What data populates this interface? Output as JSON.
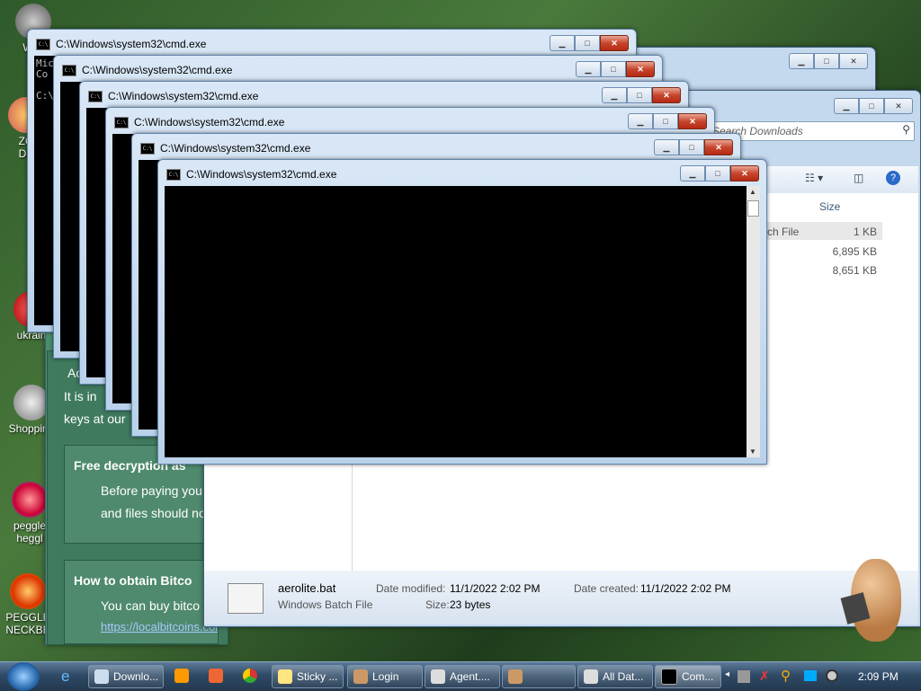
{
  "desktop_icons": [
    {
      "label": "WIN",
      "sub": "W"
    },
    {
      "label": "ZO",
      "sub": "DE"
    },
    {
      "label": "ukrain"
    },
    {
      "label": "Shopping"
    },
    {
      "label": "peggle",
      "sub": "heggl"
    },
    {
      "label": "PEGGLE",
      "sub": "NECKBE"
    }
  ],
  "cmd_windows": [
    {
      "title": "C:\\Windows\\system32\\cmd.exe"
    },
    {
      "title": "C:\\Windows\\system32\\cmd.exe"
    },
    {
      "title": "C:\\Windows\\system32\\cmd.exe"
    },
    {
      "title": "C:\\Windows\\system32\\cmd.exe"
    },
    {
      "title": "C:\\Windows\\system32\\cmd.exe"
    },
    {
      "title": "C:\\Windows\\system32\\cmd.exe"
    }
  ],
  "cmd_back_text": [
    "Mic",
    "Co",
    "C:\\Use"
  ],
  "explorer": {
    "search_placeholder": "Search Downloads",
    "column_size": "Size",
    "rows": [
      {
        "type": "atch File",
        "size": "1 KB"
      },
      {
        "type": "",
        "size": "6,895 KB"
      },
      {
        "type": "",
        "size": "8,651 KB"
      }
    ],
    "details": {
      "filename": "aerolite.bat",
      "filetype": "Windows Batch File",
      "date_modified_label": "Date modified:",
      "date_modified": "11/1/2022 2:02 PM",
      "date_created_label": "Date created:",
      "date_created": "11/1/2022 2:02 PM",
      "size_label": "Size:",
      "size": "23 bytes"
    }
  },
  "ransom": {
    "heading_partial": "Ac",
    "line1": "It is in",
    "line2": "keys at our",
    "box1_title": "Free decryption as",
    "box1_l1": "Before paying you",
    "box1_l2": "and files should no",
    "box2_title": "How to obtain Bitco",
    "box2_l1": "You can buy bitco",
    "box2_link": "https://localbitcoins.com/buy_bitcoins"
  },
  "taskbar": {
    "buttons": [
      {
        "label": "Downlo..."
      },
      {
        "label": "Sticky ..."
      },
      {
        "label": "Login"
      },
      {
        "label": "Agent...."
      },
      {
        "label": ""
      },
      {
        "label": "All Dat..."
      },
      {
        "label": "Com..."
      }
    ],
    "clock": "2:09 PM"
  },
  "colors": {
    "accent": "#3f7a5e",
    "taskbar": "#2f4a66",
    "link": "#a8c8ff"
  }
}
